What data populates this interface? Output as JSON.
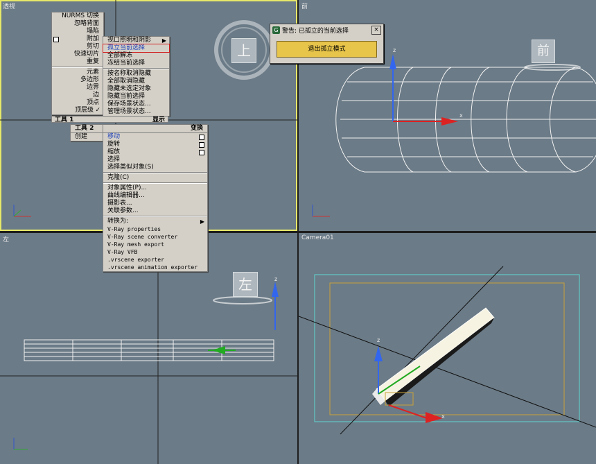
{
  "viewports": {
    "perspective": {
      "label": "透视",
      "cube_label": "上"
    },
    "front": {
      "label": "前",
      "cube_label": "前"
    },
    "left": {
      "label": "左",
      "cube_label": "左"
    },
    "camera": {
      "label": "Camera01"
    }
  },
  "axis_labels": {
    "x": "x",
    "y": "y",
    "z": "z"
  },
  "quad_menu_left": {
    "items": [
      "NURMS 切换",
      "忽略背面",
      "塌陷",
      "附加",
      "剪切",
      "快速切片",
      "重复",
      "元素",
      "多边形",
      "边界",
      "边",
      "顶点",
      "顶层级"
    ],
    "footer_left": "工具 1",
    "footer_right": "显示"
  },
  "quad_menu_display": {
    "items": [
      "视口照明和阴影",
      "孤立当前选择",
      "全部解冻",
      "冻结当前选择",
      "按名称取消隐藏",
      "全部取消隐藏",
      "隐藏未选定对象",
      "隐藏当前选择",
      "保存场景状态...",
      "管理场景状态..."
    ]
  },
  "quad_menu_tools2": {
    "header_left": "工具 2",
    "item": "创建"
  },
  "quad_menu_transform": {
    "header_right": "变换",
    "items": [
      "移动",
      "旋转",
      "缩放",
      "选择",
      "选择类似对象(S)",
      "克隆(C)",
      "对象属性(P)...",
      "曲线编辑器...",
      "摄影表...",
      "关联参数...",
      "转换为:",
      "V-Ray properties",
      "V-Ray scene converter",
      "V-Ray mesh export",
      "V-Ray VFB",
      ".vrscene exporter",
      ".vrscene animation exporter"
    ]
  },
  "dialog": {
    "title": "警告: 已孤立的当前选择",
    "close": "×",
    "button": "退出孤立模式"
  }
}
